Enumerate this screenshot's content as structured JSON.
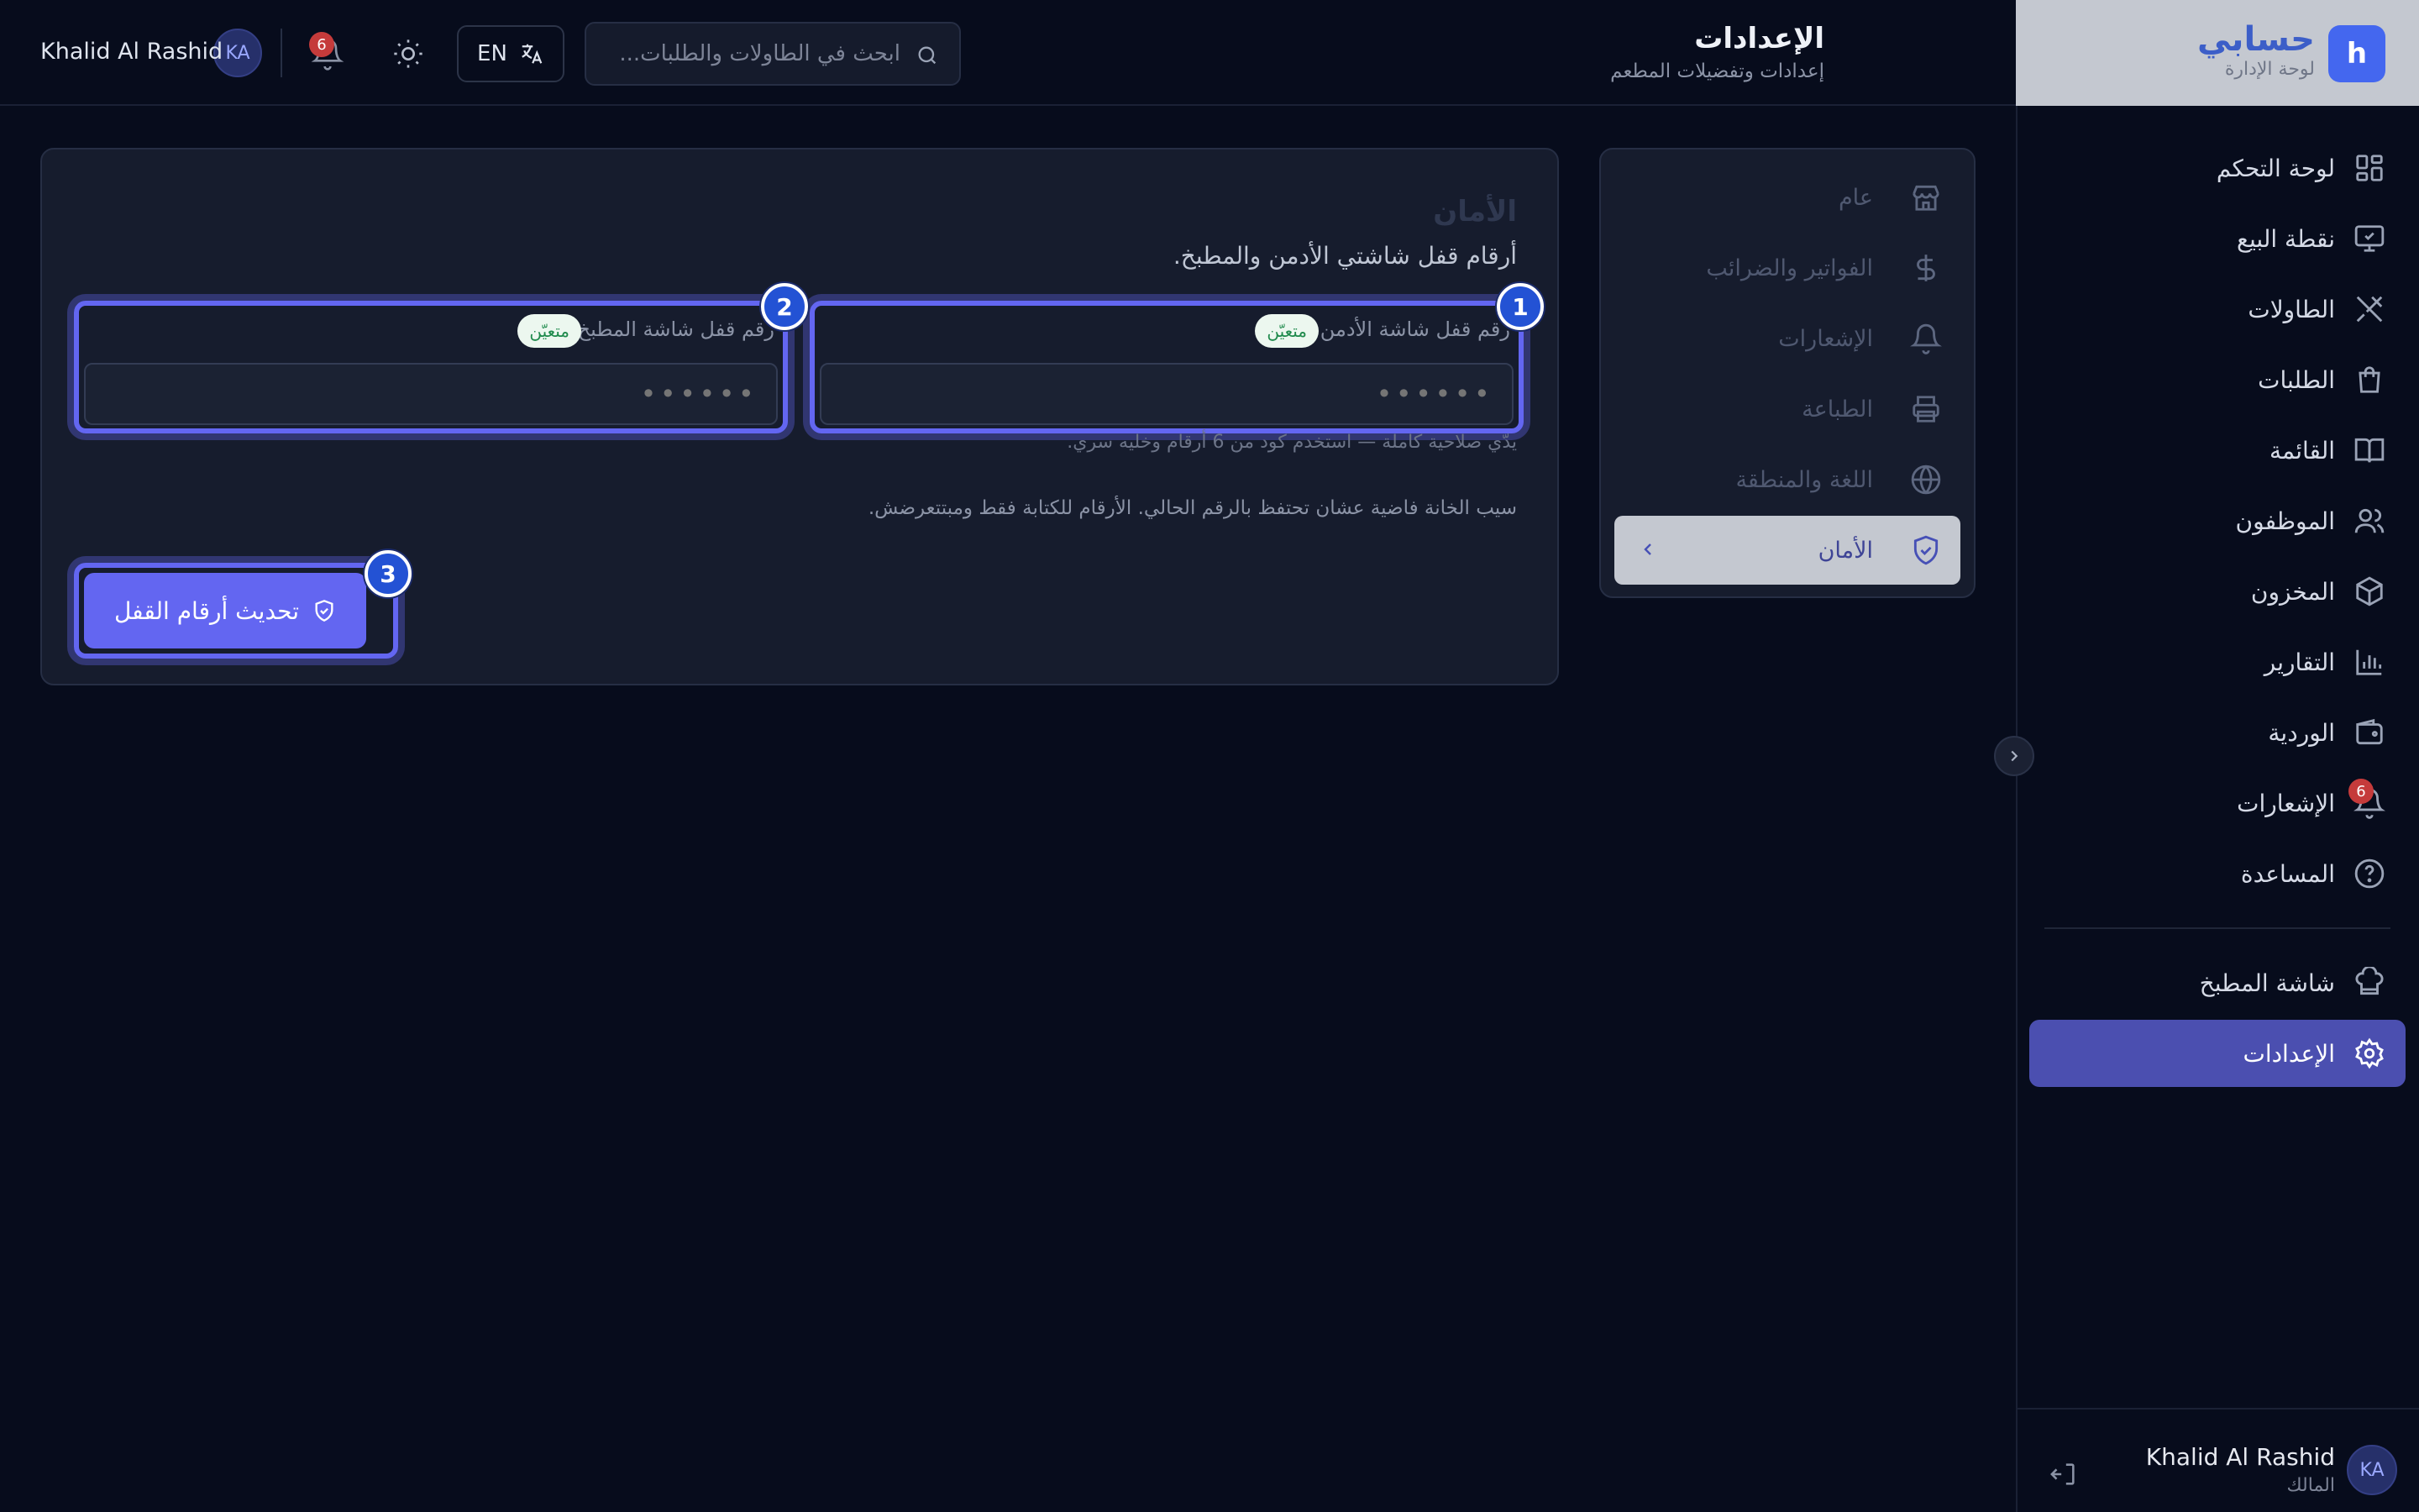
{
  "brand": {
    "name": "حسابي",
    "subtitle": "لوحة الإدارة",
    "logo_letter": "h"
  },
  "header": {
    "title": "الإعدادات",
    "subtitle": "إعدادات وتفضيلات المطعم",
    "search_placeholder": "ابحث في الطاولات والطلبات...",
    "language_label": "EN",
    "notification_count": "6",
    "user_name": "Khalid Al Rashid",
    "user_initials": "KA"
  },
  "sidebar": {
    "items": [
      {
        "label": "لوحة التحكم",
        "icon": "dashboard-icon"
      },
      {
        "label": "نقطة البيع",
        "icon": "monitor-icon"
      },
      {
        "label": "الطاولات",
        "icon": "utensils-icon"
      },
      {
        "label": "الطلبات",
        "icon": "shopping-bag-icon"
      },
      {
        "label": "القائمة",
        "icon": "book-icon"
      },
      {
        "label": "الموظفون",
        "icon": "users-icon"
      },
      {
        "label": "المخزون",
        "icon": "package-icon"
      },
      {
        "label": "التقارير",
        "icon": "bar-chart-icon"
      },
      {
        "label": "الوردية",
        "icon": "wallet-icon"
      },
      {
        "label": "الإشعارات",
        "icon": "bell-icon",
        "badge": "6"
      },
      {
        "label": "المساعدة",
        "icon": "help-circle-icon"
      },
      {
        "label": "شاشة المطبخ",
        "icon": "chef-hat-icon"
      },
      {
        "label": "الإعدادات",
        "icon": "gear-icon",
        "active": true
      }
    ],
    "user": {
      "name": "Khalid Al Rashid",
      "role": "المالك",
      "initials": "KA"
    }
  },
  "settings_nav": {
    "items": [
      {
        "label": "عام",
        "icon": "store-icon"
      },
      {
        "label": "الفواتير والضرائب",
        "icon": "dollar-icon"
      },
      {
        "label": "الإشعارات",
        "icon": "bell-icon"
      },
      {
        "label": "الطباعة",
        "icon": "printer-icon"
      },
      {
        "label": "اللغة والمنطقة",
        "icon": "globe-icon"
      },
      {
        "label": "الأمان",
        "icon": "shield-check-icon",
        "active": true
      }
    ]
  },
  "security": {
    "title": "الأمان",
    "subtitle": "أرقام قفل شاشتي الأدمن والمطبخ.",
    "admin_pin": {
      "label": "رقم قفل شاشة الأدمن",
      "status": "متعيّن",
      "value": "••••••"
    },
    "kitchen_pin": {
      "label": "رقم قفل شاشة المطبخ",
      "status": "متعيّن",
      "value": "••••••"
    },
    "help_text": "يدّي صلاحية كاملة — استخدم كود من 6 أرقام وخليه سري.",
    "note_text": "سيب الخانة فاضية عشان تحتفظ بالرقم الحالي. الأرقام للكتابة فقط ومبتتعرضش.",
    "submit_label": "تحديث أرقام القفل"
  },
  "annotations": {
    "step_1": "1",
    "step_2": "2",
    "step_3": "3"
  },
  "colors": {
    "background": "#070c1c",
    "accent": "#6366f1",
    "brand_blue": "#4467ef",
    "badge_red": "#c53b3b",
    "status_green": "#1f8a4c"
  }
}
